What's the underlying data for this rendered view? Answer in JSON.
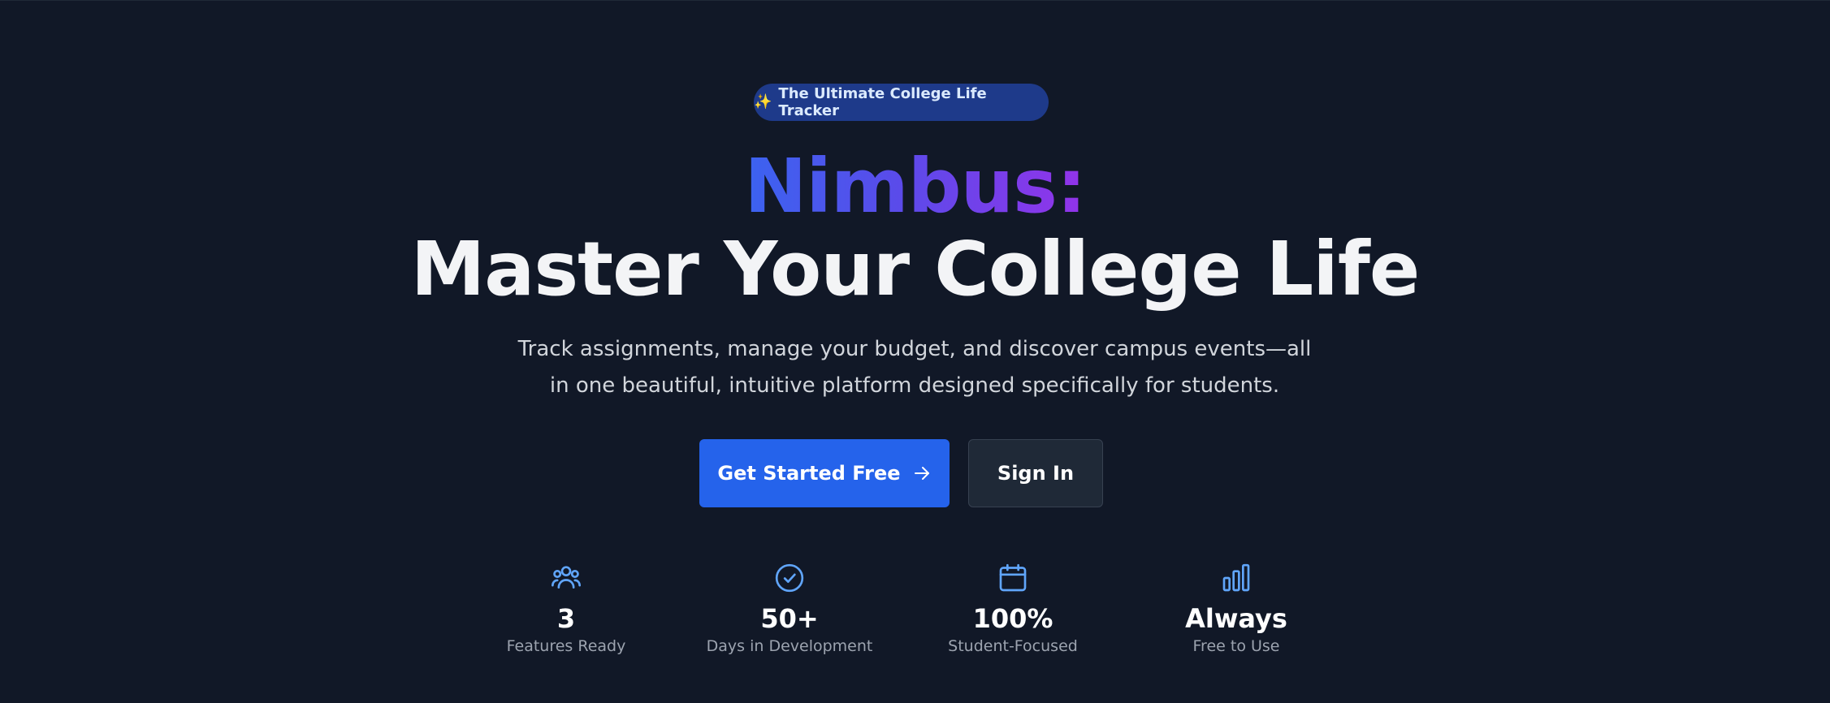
{
  "hero": {
    "badge": {
      "icon": "sparkles-icon",
      "label": "The Ultimate College Life Tracker"
    },
    "title_line1": "Nimbus:",
    "title_line2": "Master Your College Life",
    "subtitle_line1": "Track assignments, manage your budget, and discover campus events—all",
    "subtitle_line2": "in one beautiful, intuitive platform designed specifically for students.",
    "primary_button": {
      "label": "Get Started Free",
      "icon": "arrow-right-icon",
      "color": "#2563eb"
    },
    "secondary_button": {
      "label": "Sign In"
    }
  },
  "stats": [
    {
      "icon": "users-icon",
      "value": "3",
      "label": "Features Ready"
    },
    {
      "icon": "check-circle-icon",
      "value": "50+",
      "label": "Days in Development"
    },
    {
      "icon": "calendar-icon",
      "value": "100%",
      "label": "Student-Focused"
    },
    {
      "icon": "bar-chart-icon",
      "value": "Always",
      "label": "Free to Use"
    }
  ],
  "colors": {
    "background": "#111827",
    "accent": "#2563eb",
    "gradient_start": "#3b63f0",
    "gradient_end": "#9333ea",
    "icon_blue": "#60a5fa"
  }
}
